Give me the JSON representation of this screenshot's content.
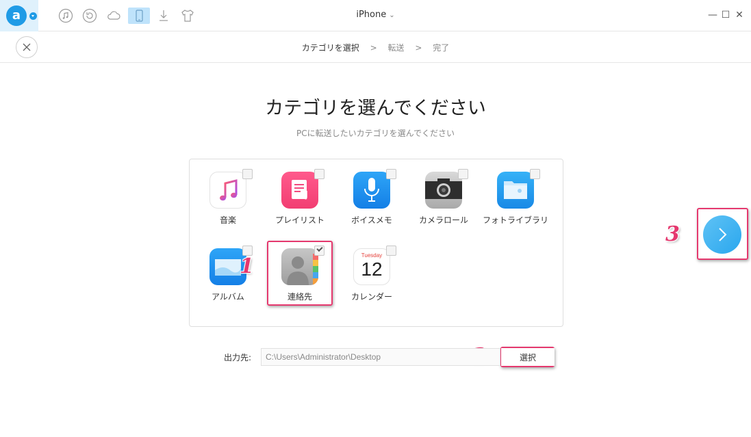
{
  "titlebar": {
    "app_logo_letter": "a",
    "device_name": "iPhone",
    "device_chevron": "⌄",
    "minimize": "—",
    "maximize": "☐",
    "close": "✕",
    "toolbar_icons": [
      "music-icon",
      "restore-icon",
      "cloud-icon",
      "phone-icon",
      "download-icon",
      "tshirt-icon"
    ]
  },
  "steps": {
    "step1": "カテゴリを選択",
    "sep1": ">",
    "step2": "転送",
    "sep2": ">",
    "step3": "完了"
  },
  "main": {
    "title": "カテゴリを選んでください",
    "subtitle": "PCに転送したいカテゴリを選んでください"
  },
  "categories": [
    {
      "label": "音楽",
      "icon": "music-app-icon",
      "checked": false
    },
    {
      "label": "プレイリスト",
      "icon": "playlist-icon",
      "checked": false
    },
    {
      "label": "ボイスメモ",
      "icon": "voice-memo-icon",
      "checked": false
    },
    {
      "label": "カメラロール",
      "icon": "camera-icon",
      "checked": false
    },
    {
      "label": "フォトライブラリ",
      "icon": "photo-library-icon",
      "checked": false
    },
    {
      "label": "アルバム",
      "icon": "album-icon",
      "checked": false
    },
    {
      "label": "連絡先",
      "icon": "contacts-icon",
      "checked": true
    },
    {
      "label": "カレンダー",
      "icon": "calendar-icon",
      "checked": false
    }
  ],
  "calendar": {
    "weekday": "Tuesday",
    "day": "12"
  },
  "output": {
    "label": "出力先:",
    "path": "C:\\Users\\Administrator\\Desktop",
    "select_label": "選択"
  },
  "annotations": {
    "mark1": "1",
    "mark2": "2",
    "mark3": "3"
  },
  "colors": {
    "accent": "#1f9be6",
    "annotation": "#e5386e"
  }
}
